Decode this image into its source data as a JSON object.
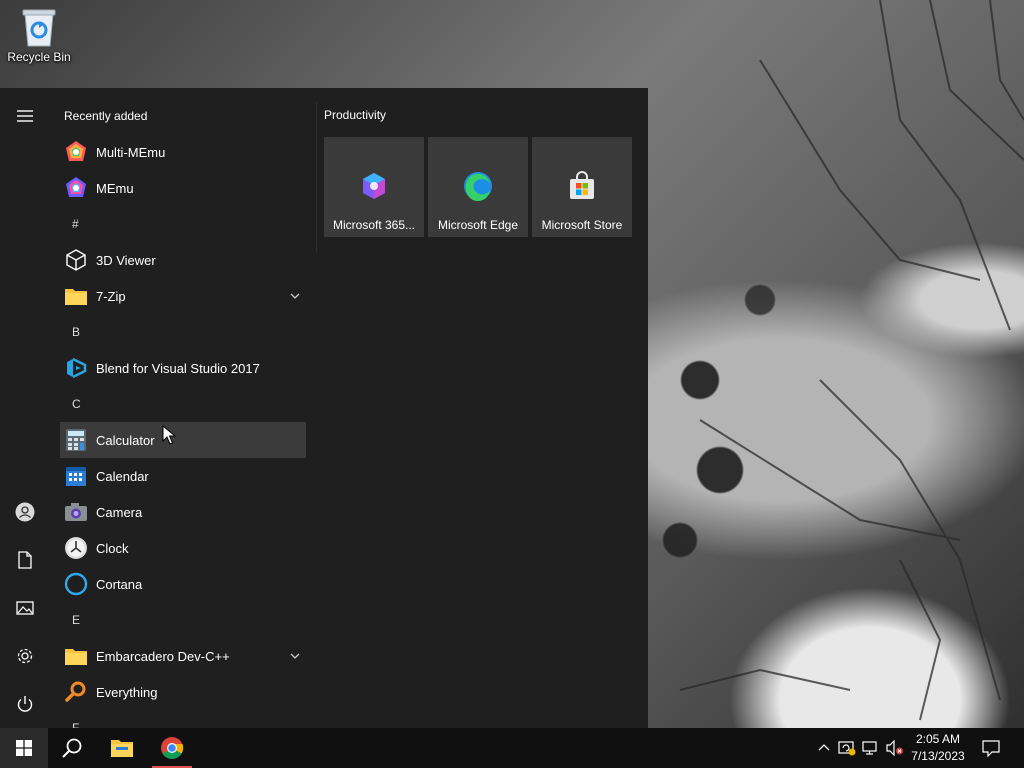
{
  "desktop": {
    "recycle_bin_label": "Recycle Bin"
  },
  "start_menu": {
    "section_title": "Recently added",
    "rail": {
      "items": [
        "menu-icon",
        "user-icon",
        "document-icon",
        "pictures-icon",
        "settings-icon",
        "power-icon"
      ]
    },
    "apps": [
      {
        "label": "Multi-MEmu",
        "icon": "multi-memu-icon"
      },
      {
        "label": "MEmu",
        "icon": "memu-icon"
      },
      {
        "letter": "#"
      },
      {
        "label": "3D Viewer",
        "icon": "3d-viewer-icon"
      },
      {
        "label": "7-Zip",
        "icon": "folder-icon",
        "expandable": true
      },
      {
        "letter": "B"
      },
      {
        "label": "Blend for Visual Studio 2017",
        "icon": "blend-icon"
      },
      {
        "letter": "C"
      },
      {
        "label": "Calculator",
        "icon": "calculator-icon",
        "hover": true
      },
      {
        "label": "Calendar",
        "icon": "calendar-icon"
      },
      {
        "label": "Camera",
        "icon": "camera-icon"
      },
      {
        "label": "Clock",
        "icon": "clock-icon"
      },
      {
        "label": "Cortana",
        "icon": "cortana-icon"
      },
      {
        "letter": "E"
      },
      {
        "label": "Embarcadero Dev-C++",
        "icon": "folder-icon",
        "expandable": true
      },
      {
        "label": "Everything",
        "icon": "everything-icon"
      },
      {
        "letter": "F"
      }
    ],
    "tiles_group": {
      "title": "Productivity",
      "tiles": [
        {
          "label": "Microsoft 365...",
          "icon": "microsoft-365-icon"
        },
        {
          "label": "Microsoft Edge",
          "icon": "edge-icon"
        },
        {
          "label": "Microsoft Store",
          "icon": "store-icon"
        }
      ]
    }
  },
  "taskbar": {
    "pinned": [
      "windows-start-icon",
      "search-icon",
      "file-explorer-icon",
      "chrome-icon"
    ],
    "tray": [
      "chevron-up-icon",
      "update-icon",
      "network-icon",
      "volume-muted-icon",
      "notification-icon"
    ],
    "time": "2:05 AM",
    "date": "7/13/2023"
  },
  "colors": {
    "menu_bg": "#1f1f1f",
    "tile_bg": "#3a3a3a",
    "hover_bg": "#3b3b3b",
    "taskbar_bg": "#101010",
    "active_indicator": "#e05050"
  }
}
